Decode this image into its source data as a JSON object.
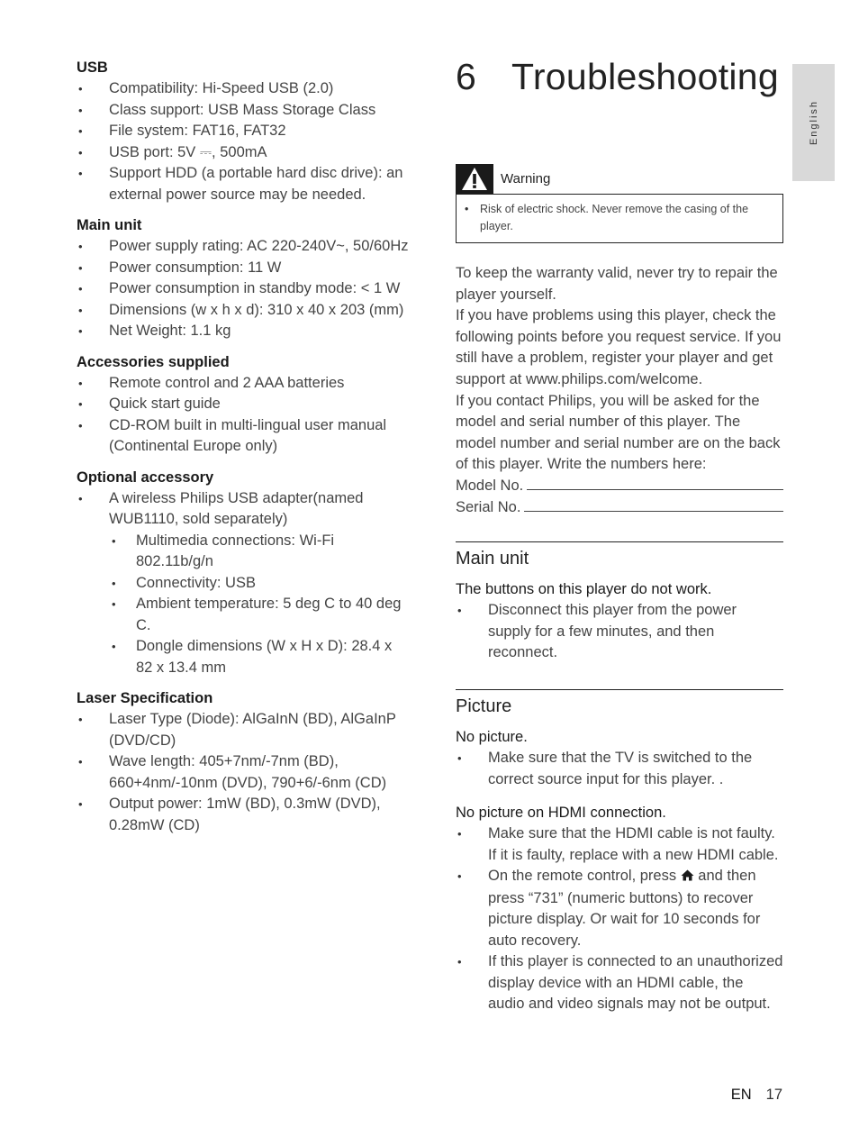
{
  "left_column": {
    "sections": [
      {
        "heading": "USB",
        "items": [
          "Compatibility: Hi-Speed USB (2.0)",
          "Class support: USB Mass Storage Class",
          "File system: FAT16, FAT32",
          "USB port: 5V ⎓, 500mA",
          "Support HDD (a portable hard disc drive): an external power source may be needed."
        ]
      },
      {
        "heading": "Main unit",
        "items": [
          "Power supply rating: AC 220-240V~, 50/60Hz",
          "Power consumption: 11 W",
          "Power consumption in standby mode: < 1 W",
          "Dimensions (w x h x d): 310 x 40 x 203 (mm)",
          "Net Weight: 1.1 kg"
        ]
      },
      {
        "heading": "Accessories supplied",
        "items": [
          "Remote control and 2 AAA batteries",
          "Quick start guide",
          "CD-ROM built in multi-lingual user manual (Continental Europe only)"
        ]
      },
      {
        "heading": "Optional accessory",
        "items": [
          "A wireless Philips USB adapter(named WUB1110, sold separately)"
        ],
        "sub_items": [
          "Multimedia connections: Wi-Fi 802.11b/g/n",
          "Connectivity: USB",
          "Ambient temperature: 5 deg C to 40 deg C.",
          "Dongle dimensions (W x H x D): 28.4 x 82 x 13.4 mm"
        ]
      },
      {
        "heading": "Laser Specification",
        "items": [
          "Laser Type (Diode): AlGaInN (BD), AlGaInP (DVD/CD)",
          "Wave length: 405+7nm/-7nm (BD), 660+4nm/-10nm (DVD), 790+6/-6nm (CD)",
          "Output power: 1mW (BD), 0.3mW (DVD), 0.28mW (CD)"
        ]
      }
    ]
  },
  "chapter": {
    "number": "6",
    "title": "Troubleshooting"
  },
  "language_tab": "English",
  "warning": {
    "icon": "warning-triangle-icon",
    "label": "Warning",
    "items": [
      "Risk of electric shock. Never remove the casing of the player."
    ]
  },
  "intro": {
    "paragraphs": [
      "To keep the warranty valid, never try to repair the player yourself.",
      "If you have problems using this player, check the following points before you request service. If you still have a problem, register your player and get support at www.philips.com/welcome.",
      "If you contact Philips, you will be asked for the model and serial number of this player. The model number and serial number are on the back of this player. Write the numbers here:"
    ],
    "model_label": "Model No.",
    "serial_label": "Serial No."
  },
  "troubleshooting": [
    {
      "title": "Main unit",
      "problems": [
        {
          "problem": "The buttons on this player do not work.",
          "solutions": [
            "Disconnect this player from the power supply for a few minutes, and then reconnect."
          ]
        }
      ]
    },
    {
      "title": "Picture",
      "problems": [
        {
          "problem": "No picture.",
          "solutions": [
            "Make sure that the TV is switched to the correct source input for this player. ."
          ]
        },
        {
          "problem": "No picture on HDMI connection.",
          "solutions": [
            "Make sure that the HDMI cable is not faulty. If it is faulty, replace with a new HDMI cable.",
            "If this player is connected to an unauthorized display device with an HDMI cable, the audio and video signals may not be output."
          ],
          "home_solution": {
            "before": "On the remote control, press",
            "icon": "home-icon",
            "after": "and then press “731” (numeric buttons) to recover picture display. Or wait for 10 seconds for auto recovery."
          }
        }
      ]
    }
  ],
  "footer": {
    "language": "EN",
    "page_number": "17"
  }
}
